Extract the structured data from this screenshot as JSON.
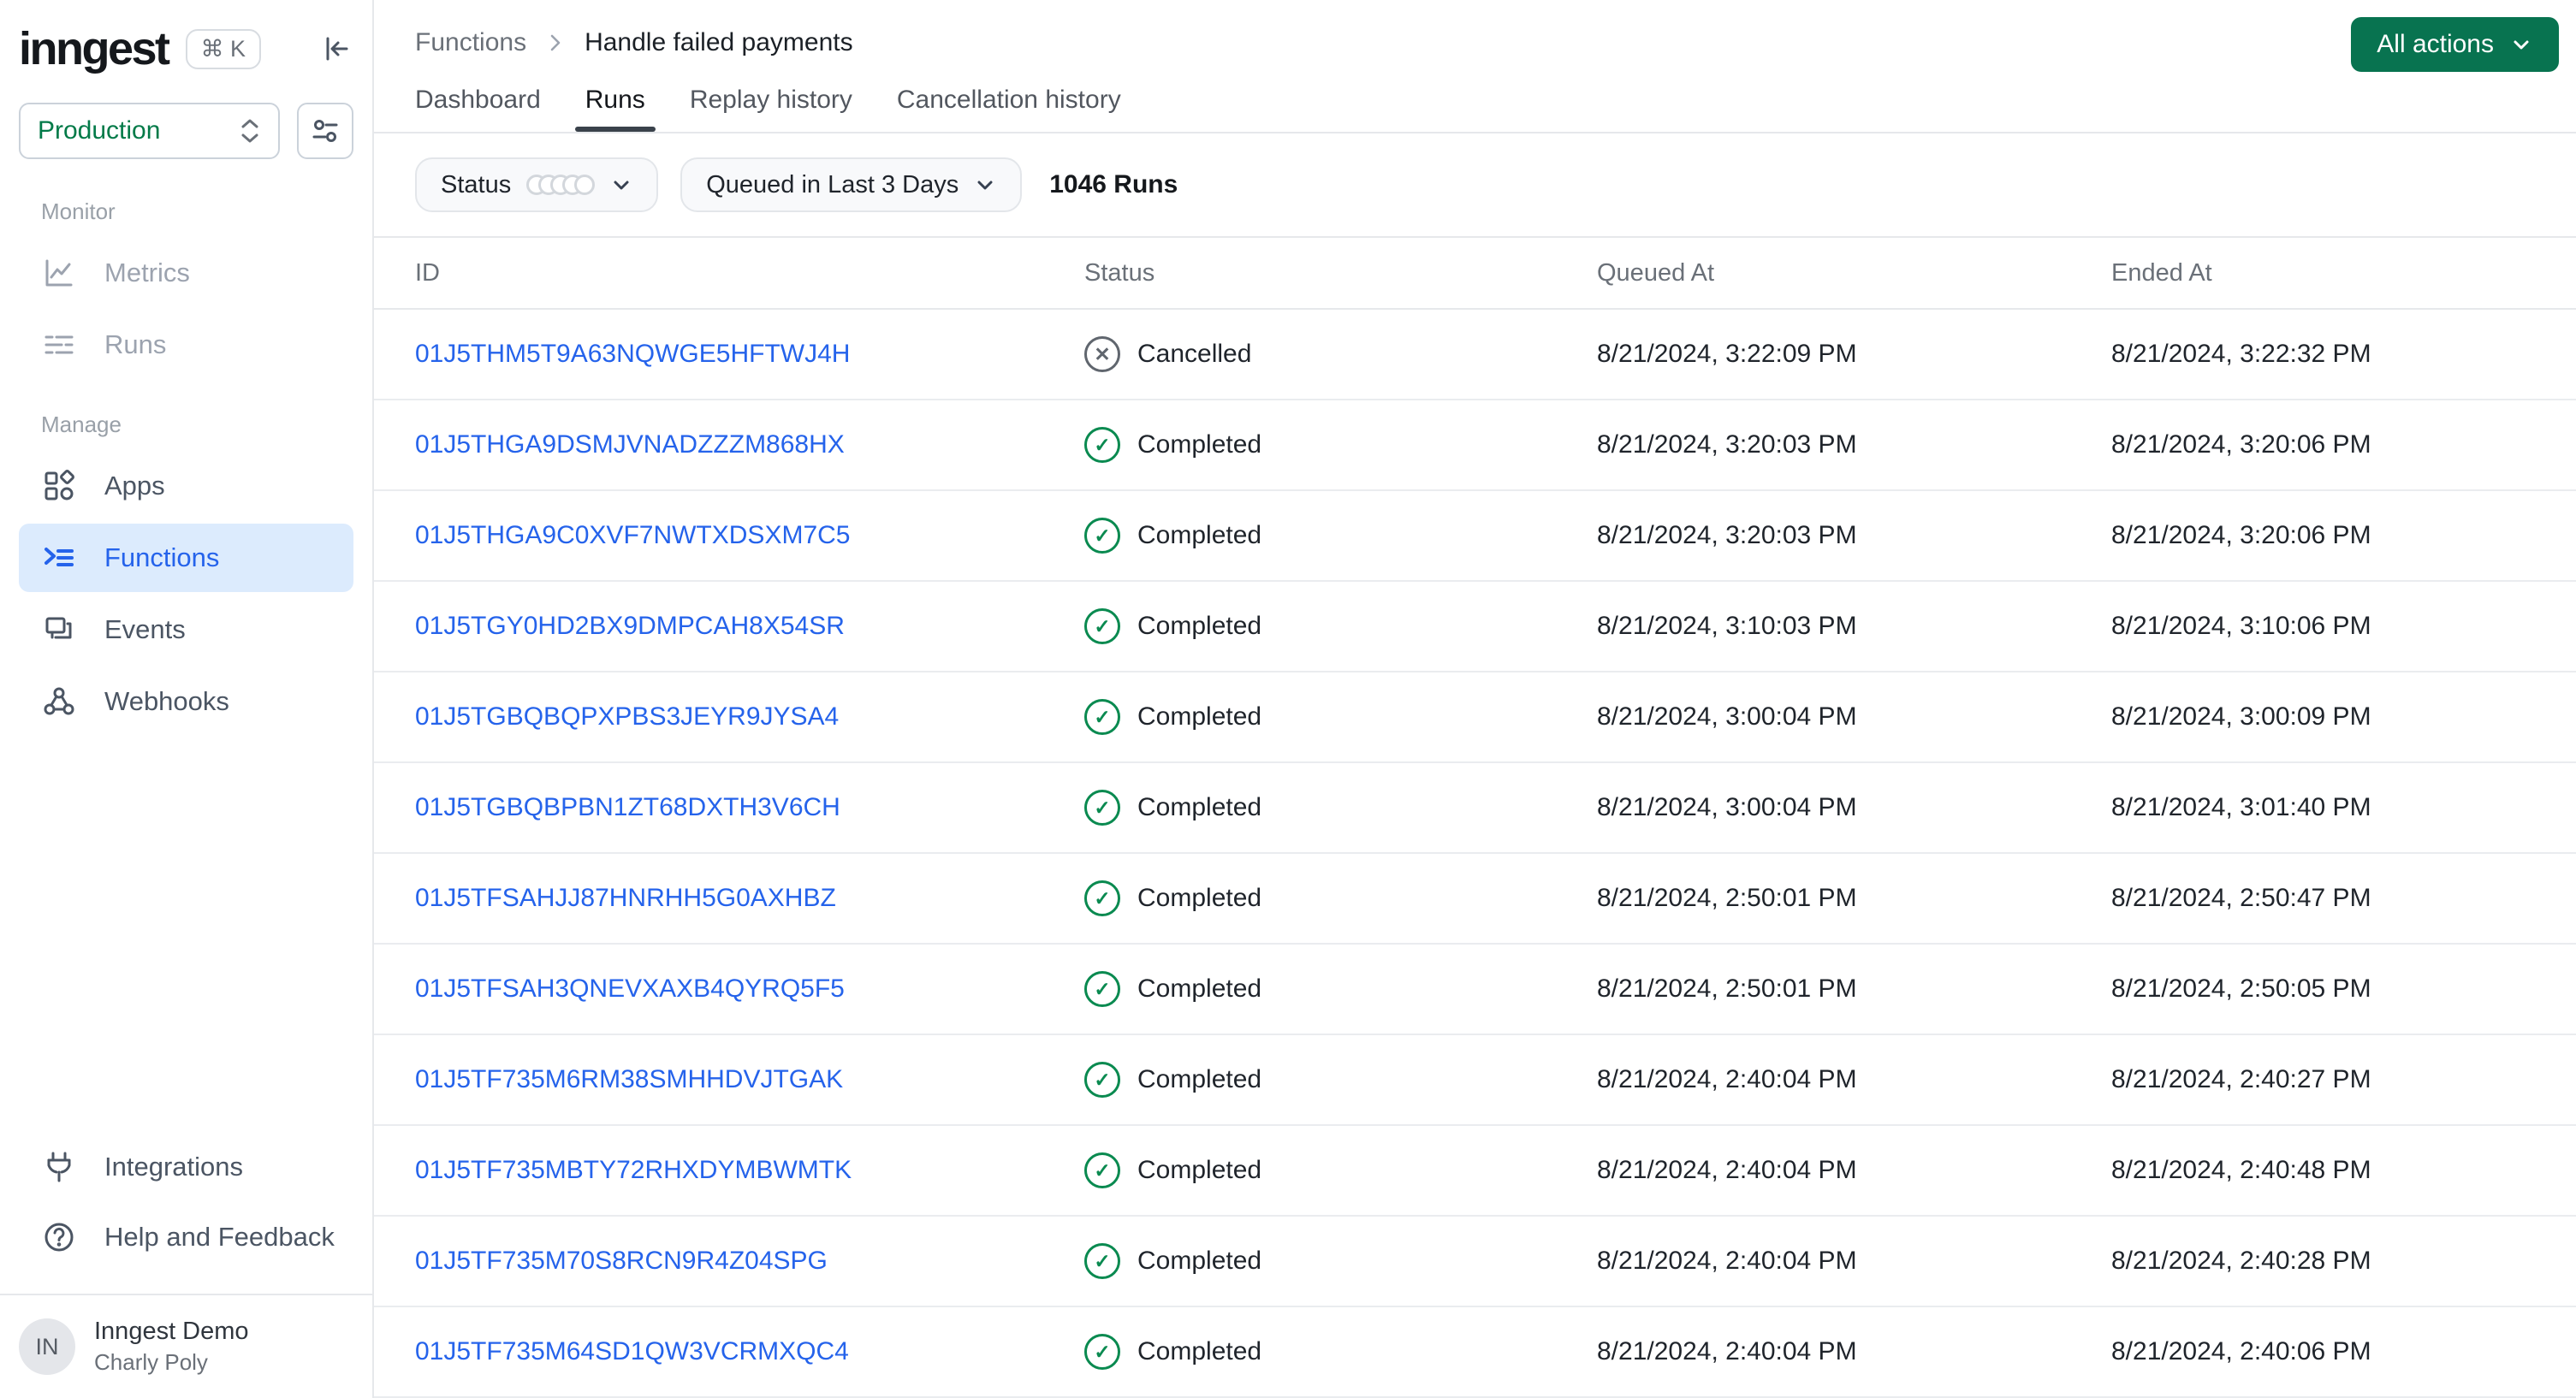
{
  "brand": {
    "logo": "inngest",
    "shortcut": "⌘ K"
  },
  "workspace": {
    "selected": "Production"
  },
  "sidebar": {
    "sections": [
      {
        "label": "Monitor",
        "items": [
          {
            "label": "Metrics",
            "icon": "metrics-chart-icon",
            "active": false
          },
          {
            "label": "Runs",
            "icon": "runs-list-icon",
            "active": false
          }
        ]
      },
      {
        "label": "Manage",
        "items": [
          {
            "label": "Apps",
            "icon": "apps-grid-icon",
            "active": false
          },
          {
            "label": "Functions",
            "icon": "functions-list-icon",
            "active": true
          },
          {
            "label": "Events",
            "icon": "events-copy-icon",
            "active": false
          },
          {
            "label": "Webhooks",
            "icon": "webhook-icon",
            "active": false
          }
        ]
      }
    ],
    "footer_items": [
      {
        "label": "Integrations",
        "icon": "plug-icon"
      },
      {
        "label": "Help and Feedback",
        "icon": "help-circle-icon"
      }
    ],
    "user": {
      "initials": "IN",
      "org": "Inngest Demo",
      "name": "Charly Poly"
    }
  },
  "header": {
    "breadcrumb": {
      "parent": "Functions",
      "current": "Handle failed payments"
    },
    "actions_button": "All actions"
  },
  "tabs": [
    {
      "label": "Dashboard",
      "active": false
    },
    {
      "label": "Runs",
      "active": true
    },
    {
      "label": "Replay history",
      "active": false
    },
    {
      "label": "Cancellation history",
      "active": false
    }
  ],
  "filters": {
    "status_label": "Status",
    "time_range_label": "Queued in Last 3 Days",
    "runs_count": "1046 Runs"
  },
  "table": {
    "columns": [
      "ID",
      "Status",
      "Queued At",
      "Ended At"
    ],
    "rows": [
      {
        "id": "01J5THM5T9A63NQWGE5HFTWJ4H",
        "status": "Cancelled",
        "status_type": "cancelled",
        "queued_at": "8/21/2024, 3:22:09 PM",
        "ended_at": "8/21/2024, 3:22:32 PM"
      },
      {
        "id": "01J5THGA9DSMJVNADZZZM868HX",
        "status": "Completed",
        "status_type": "completed",
        "queued_at": "8/21/2024, 3:20:03 PM",
        "ended_at": "8/21/2024, 3:20:06 PM"
      },
      {
        "id": "01J5THGA9C0XVF7NWTXDSXM7C5",
        "status": "Completed",
        "status_type": "completed",
        "queued_at": "8/21/2024, 3:20:03 PM",
        "ended_at": "8/21/2024, 3:20:06 PM"
      },
      {
        "id": "01J5TGY0HD2BX9DMPCAH8X54SR",
        "status": "Completed",
        "status_type": "completed",
        "queued_at": "8/21/2024, 3:10:03 PM",
        "ended_at": "8/21/2024, 3:10:06 PM"
      },
      {
        "id": "01J5TGBQBQPXPBS3JEYR9JYSA4",
        "status": "Completed",
        "status_type": "completed",
        "queued_at": "8/21/2024, 3:00:04 PM",
        "ended_at": "8/21/2024, 3:00:09 PM"
      },
      {
        "id": "01J5TGBQBPBN1ZT68DXTH3V6CH",
        "status": "Completed",
        "status_type": "completed",
        "queued_at": "8/21/2024, 3:00:04 PM",
        "ended_at": "8/21/2024, 3:01:40 PM"
      },
      {
        "id": "01J5TFSAHJJ87HNRHH5G0AXHBZ",
        "status": "Completed",
        "status_type": "completed",
        "queued_at": "8/21/2024, 2:50:01 PM",
        "ended_at": "8/21/2024, 2:50:47 PM"
      },
      {
        "id": "01J5TFSAH3QNEVXAXB4QYRQ5F5",
        "status": "Completed",
        "status_type": "completed",
        "queued_at": "8/21/2024, 2:50:01 PM",
        "ended_at": "8/21/2024, 2:50:05 PM"
      },
      {
        "id": "01J5TF735M6RM38SMHHDVJTGAK",
        "status": "Completed",
        "status_type": "completed",
        "queued_at": "8/21/2024, 2:40:04 PM",
        "ended_at": "8/21/2024, 2:40:27 PM"
      },
      {
        "id": "01J5TF735MBTY72RHXDYMBWMTK",
        "status": "Completed",
        "status_type": "completed",
        "queued_at": "8/21/2024, 2:40:04 PM",
        "ended_at": "8/21/2024, 2:40:48 PM"
      },
      {
        "id": "01J5TF735M70S8RCN9R4Z04SPG",
        "status": "Completed",
        "status_type": "completed",
        "queued_at": "8/21/2024, 2:40:04 PM",
        "ended_at": "8/21/2024, 2:40:28 PM"
      },
      {
        "id": "01J5TF735M64SD1QW3VCRMXQC4",
        "status": "Completed",
        "status_type": "completed",
        "queued_at": "8/21/2024, 2:40:04 PM",
        "ended_at": "8/21/2024, 2:40:06 PM"
      }
    ]
  },
  "colors": {
    "brand_green": "#087350",
    "completed_green": "#0A8A50",
    "cancelled_gray": "#60666E",
    "link_blue": "#2563EB",
    "active_nav_bg": "#DCEBFD",
    "production_green": "#027A48"
  }
}
